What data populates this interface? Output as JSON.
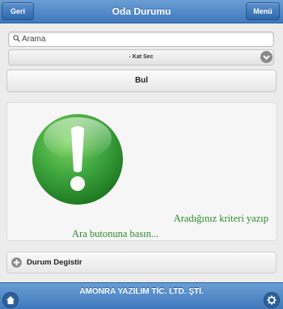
{
  "header": {
    "title": "Oda Durumu",
    "back_label": "Geri",
    "menu_label": "Menü"
  },
  "search": {
    "placeholder": "Arama"
  },
  "select": {
    "selected": "- Kat Sec"
  },
  "search_button": {
    "label": "Bul"
  },
  "content": {
    "icon": "exclamation-icon",
    "message_line1": "Aradığınız kriteri yazıp",
    "message_line2": "Ara butonuna basın..."
  },
  "collapsible": {
    "label": "Durum Degistir",
    "icon": "plus-circle-icon"
  },
  "footer": {
    "title": "AMONRA YAZILIM TİC. LTD. ŞTİ.",
    "left_icon": "home-icon",
    "right_icon": "gear-icon"
  },
  "colors": {
    "header_bar": "#4a86c8",
    "accent_green": "#2e8b2e",
    "icon_green": "#3fa63f"
  }
}
